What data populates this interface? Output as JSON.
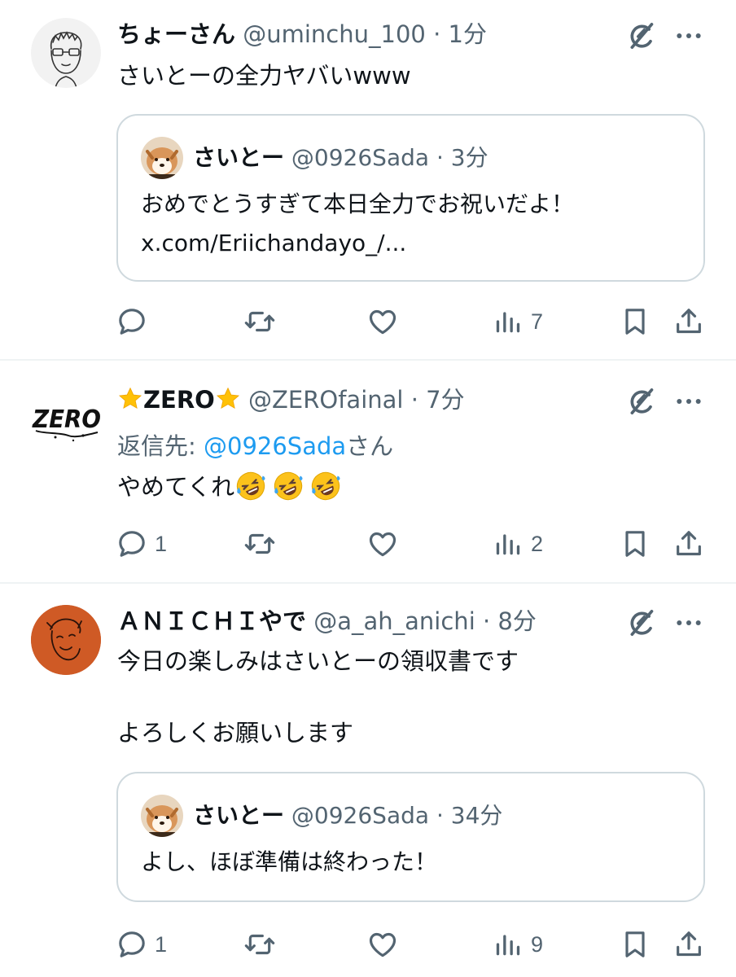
{
  "posts": [
    {
      "display_name": "ちょーさん",
      "handle": "@uminchu_100",
      "separator": "·",
      "time": "1分",
      "text": "さいとーの全力ヤバいwww",
      "quote": {
        "display_name": "さいとー",
        "handle": "@0926Sada",
        "separator": "·",
        "time": "3分",
        "line1": "おめでとうすぎて本日全力でお祝いだよ！",
        "line2": "x.com/Eriichandayo_/..."
      },
      "views": "7"
    },
    {
      "display_name": "ZERO",
      "name_emoji": "star",
      "handle": "@ZEROfainal",
      "separator": "·",
      "time": "7分",
      "reply_prefix": "返信先: ",
      "reply_mention": "@0926Sada",
      "reply_suffix": "さん",
      "text": "やめてくれ",
      "text_emoji": "rolling-on-floor-laughing x3",
      "replies": "1",
      "views": "2"
    },
    {
      "display_name": "ＡＮＩＣＨＩやで",
      "handle": "@a_ah_anichi",
      "separator": "·",
      "time": "8分",
      "line1": "今日の楽しみはさいとーの領収書です",
      "line2": "よろしくお願いします",
      "quote": {
        "display_name": "さいとー",
        "handle": "@0926Sada",
        "separator": "·",
        "time": "34分",
        "line1": "よし、ほぼ準備は終わった！"
      },
      "replies": "1",
      "views": "9"
    }
  ],
  "colors": {
    "text": "#0f1419",
    "secondary": "#536471",
    "link": "#1d9bf0",
    "border": "#cfd9de",
    "divider": "#eff3f4"
  },
  "icons": [
    "reply-icon",
    "repost-icon",
    "like-icon",
    "views-icon",
    "bookmark-icon",
    "share-icon",
    "grok-icon",
    "more-icon"
  ]
}
